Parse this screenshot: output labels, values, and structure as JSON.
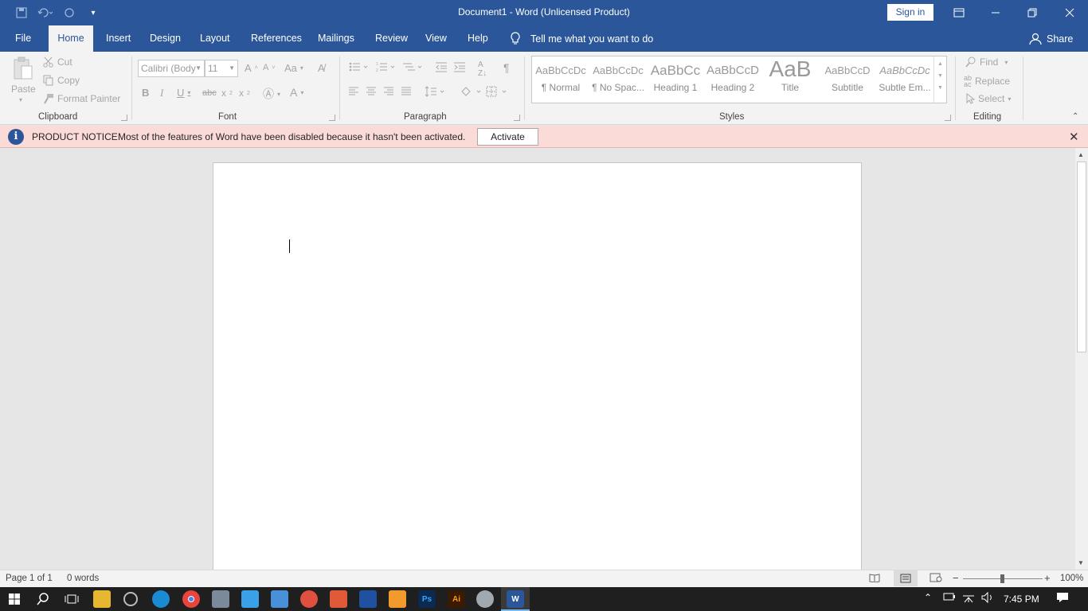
{
  "window": {
    "title": "Document1  -  Word (Unlicensed Product)",
    "sign_in": "Sign in"
  },
  "tabs": [
    "File",
    "Home",
    "Insert",
    "Design",
    "Layout",
    "References",
    "Mailings",
    "Review",
    "View",
    "Help"
  ],
  "tell_me": "Tell me what you want to do",
  "share": "Share",
  "ribbon": {
    "clipboard": {
      "label": "Clipboard",
      "paste": "Paste",
      "cut": "Cut",
      "copy": "Copy",
      "format_painter": "Format Painter"
    },
    "font": {
      "label": "Font",
      "name": "Calibri (Body",
      "size": "11"
    },
    "paragraph": {
      "label": "Paragraph"
    },
    "styles": {
      "label": "Styles",
      "items": [
        {
          "sample": "AaBbCcDc",
          "name": "¶ Normal"
        },
        {
          "sample": "AaBbCcDc",
          "name": "¶ No Spac..."
        },
        {
          "sample": "AaBbCc",
          "name": "Heading 1"
        },
        {
          "sample": "AaBbCcD",
          "name": "Heading 2"
        },
        {
          "sample": "AaB",
          "name": "Title"
        },
        {
          "sample": "AaBbCcD",
          "name": "Subtitle"
        },
        {
          "sample": "AaBbCcDc",
          "name": "Subtle Em..."
        }
      ]
    },
    "editing": {
      "label": "Editing",
      "find": "Find",
      "replace": "Replace",
      "select": "Select"
    }
  },
  "notice": {
    "title": "PRODUCT NOTICE",
    "message": "Most of the features of Word have been disabled because it hasn't been activated.",
    "activate": "Activate"
  },
  "status": {
    "page": "Page 1 of 1",
    "words": "0 words",
    "zoom": "100%"
  },
  "taskbar": {
    "time": "7:45 PM"
  },
  "colors": {
    "brand": "#2b579a",
    "notice_bg": "#fadbd8"
  }
}
